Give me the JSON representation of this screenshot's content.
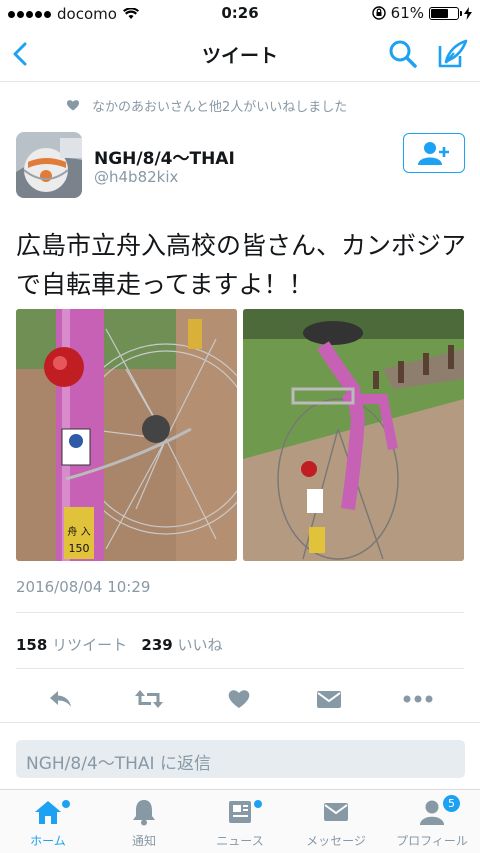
{
  "statusbar": {
    "carrier": "docomo",
    "time": "0:26",
    "battery": "61%",
    "battery_level": 0.61
  },
  "navbar": {
    "title": "ツイート"
  },
  "social_context": "なかのあおいさんと他2人がいいねしました",
  "tweet": {
    "name": "NGH/8/4〜THAI",
    "handle": "@h4b82kix",
    "text": "広島市立舟入高校の皆さん、カンボジアで自転車走ってますよ！！",
    "timestamp": "2016/08/04 10:29",
    "retweet_count": "158",
    "retweet_label": "リツイート",
    "like_count": "239",
    "like_label": "いいね",
    "photo_sticker_number": "150",
    "photo_sticker_kanji": "舟 入"
  },
  "reply": {
    "placeholder": "NGH/8/4〜THAI に返信"
  },
  "tabs": [
    {
      "label": "ホーム"
    },
    {
      "label": "通知"
    },
    {
      "label": "ニュース"
    },
    {
      "label": "メッセージ"
    },
    {
      "label": "プロフィール",
      "badge": "5"
    }
  ],
  "colors": {
    "accent": "#1da1f2",
    "muted": "#8899a6"
  }
}
